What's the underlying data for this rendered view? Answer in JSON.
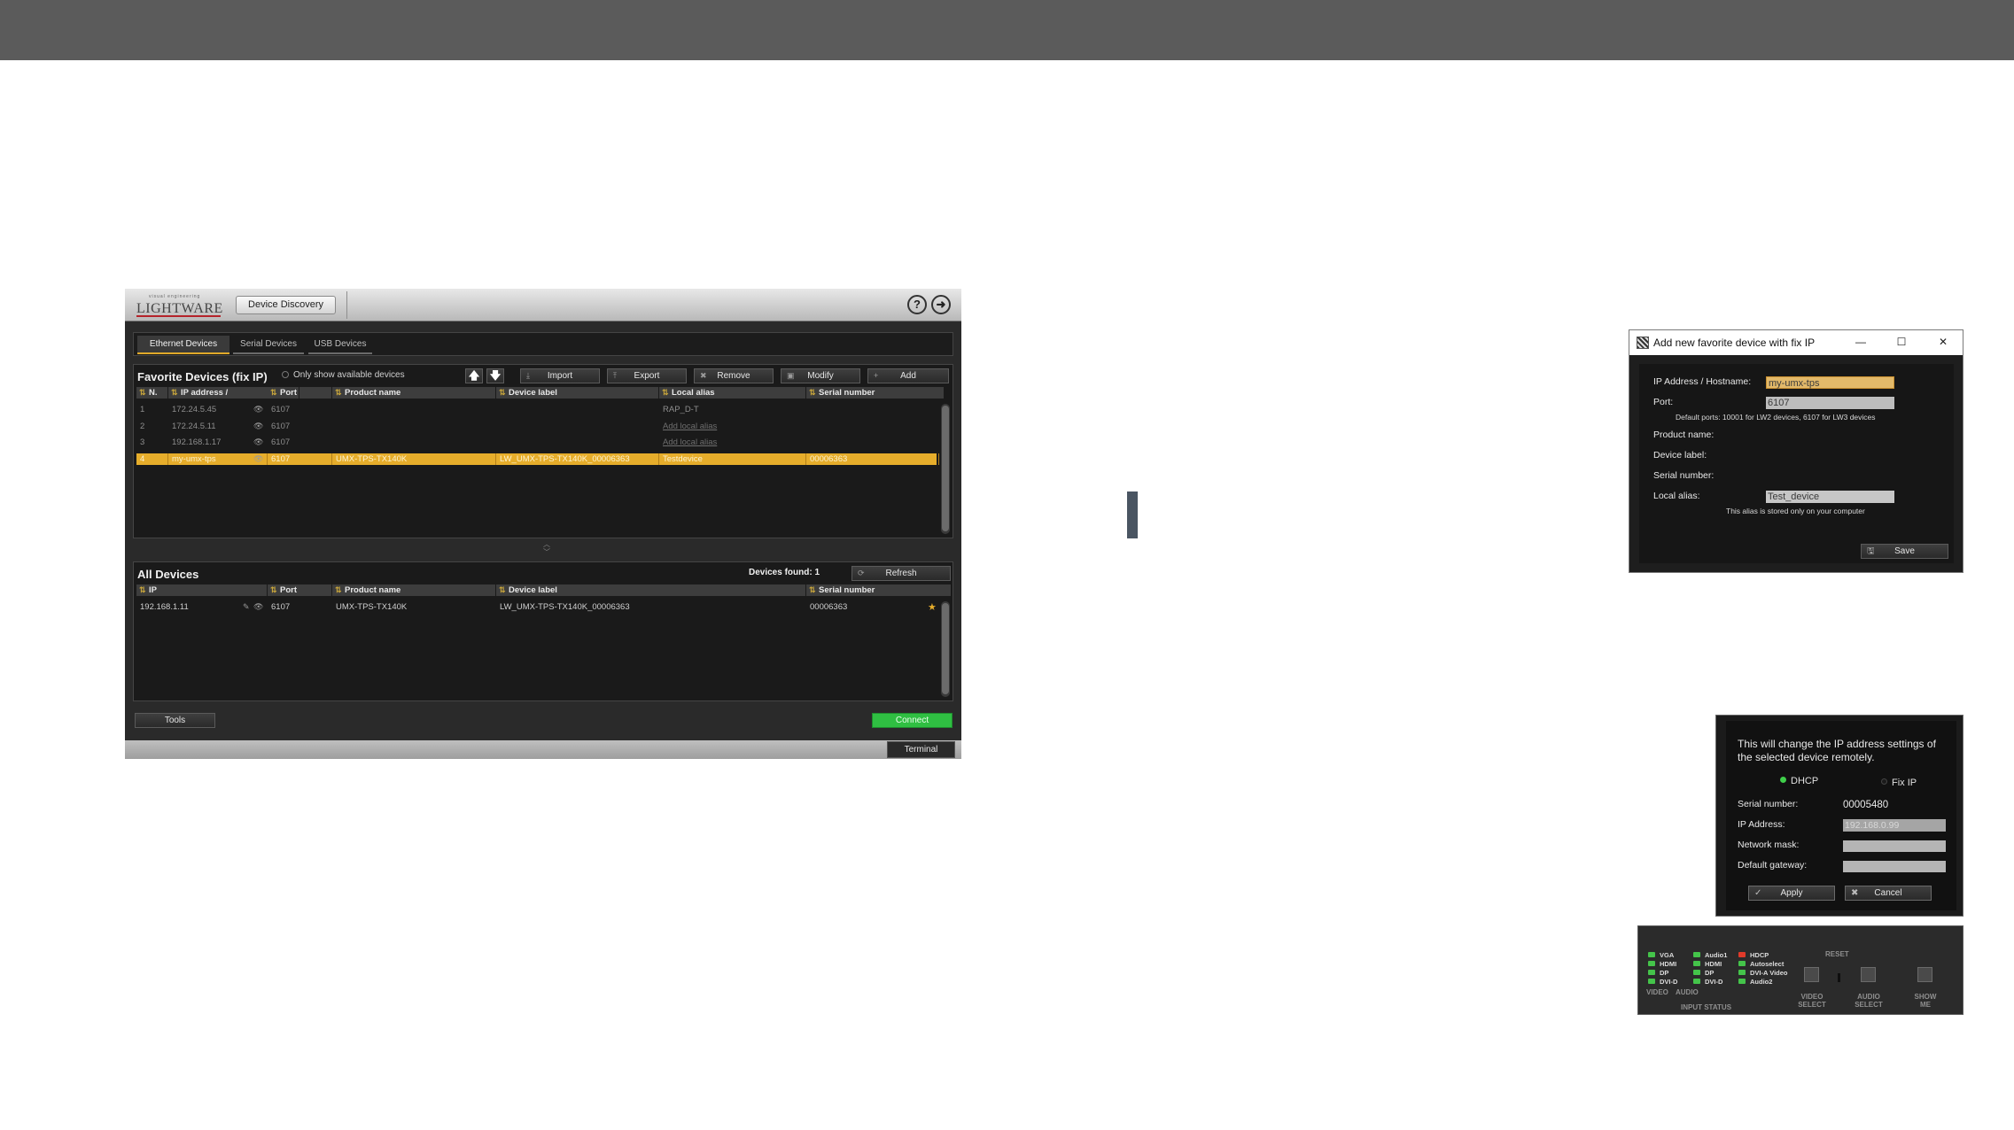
{
  "main_window": {
    "logo": {
      "small": "visual engineering",
      "big": "LIGHTWARE"
    },
    "discovery_button": "Device Discovery",
    "tabs": [
      "Ethernet Devices",
      "Serial Devices",
      "USB Devices"
    ],
    "favorites": {
      "title": "Favorite Devices (fix IP)",
      "only_available": "Only show available devices",
      "buttons": {
        "up": "🡅",
        "down": "🡇",
        "import": "Import",
        "export": "Export",
        "remove": "Remove",
        "modify": "Modify",
        "add": "Add"
      },
      "columns": [
        "N.",
        "IP address /",
        "Port",
        "Product name",
        "Device label",
        "Local alias",
        "Serial number"
      ],
      "rows": [
        {
          "n": "1",
          "ip": "172.24.5.45",
          "port": "6107",
          "product": "",
          "label": "",
          "alias": "RAP_D-T",
          "serial": "",
          "alias_placeholder": false,
          "selected": false
        },
        {
          "n": "2",
          "ip": "172.24.5.11",
          "port": "6107",
          "product": "",
          "label": "",
          "alias": "Add local alias",
          "serial": "",
          "alias_placeholder": true,
          "selected": false
        },
        {
          "n": "3",
          "ip": "192.168.1.17",
          "port": "6107",
          "product": "",
          "label": "",
          "alias": "Add local alias",
          "serial": "",
          "alias_placeholder": true,
          "selected": false
        },
        {
          "n": "4",
          "ip": "my-umx-tps",
          "port": "6107",
          "product": "UMX-TPS-TX140K",
          "label": "LW_UMX-TPS-TX140K_00006363",
          "alias": "Testdevice",
          "serial": "00006363",
          "alias_placeholder": false,
          "selected": true
        }
      ]
    },
    "all_devices": {
      "title": "All Devices",
      "devices_found": "Devices found: 1",
      "refresh": "Refresh",
      "columns": [
        "IP",
        "Port",
        "Product name",
        "Device label",
        "Serial number"
      ],
      "rows": [
        {
          "ip": "192.168.1.11",
          "port": "6107",
          "product": "UMX-TPS-TX140K",
          "label": "LW_UMX-TPS-TX140K_00006363",
          "serial": "00006363"
        }
      ]
    },
    "tools": "Tools",
    "connect": "Connect",
    "terminal": "Terminal"
  },
  "add_favorite_dialog": {
    "title": "Add new favorite device with fix IP",
    "ip_label": "IP Address / Hostname:",
    "ip_value": "my-umx-tps",
    "port_label": "Port:",
    "port_value": "6107",
    "ports_hint": "Default ports: 10001 for LW2 devices, 6107 for LW3 devices",
    "product_label": "Product name:",
    "device_label_label": "Device label:",
    "serial_label": "Serial number:",
    "alias_label": "Local alias:",
    "alias_value": "Test_device",
    "alias_hint": "This alias is stored only on your computer",
    "save": "Save"
  },
  "ip_settings_dialog": {
    "message": "This will change the IP address settings of the selected device remotely.",
    "dhcp": "DHCP",
    "fix_ip": "Fix IP",
    "serial_label": "Serial number:",
    "serial_value": "00005480",
    "ip_label": "IP Address:",
    "ip_value": "192.168.0.99",
    "mask_label": "Network mask:",
    "mask_value": "",
    "gateway_label": "Default gateway:",
    "gateway_value": "",
    "apply": "Apply",
    "cancel": "Cancel"
  },
  "front_panel": {
    "video_leds": [
      "VGA",
      "HDMI",
      "DP",
      "DVI-D"
    ],
    "audio_leds": [
      "Audio1",
      "HDMI",
      "DP",
      "DVI-D"
    ],
    "status_leds": [
      "HDCP",
      "Autoselect",
      "DVI-A Video",
      "Audio2"
    ],
    "video": "VIDEO",
    "audio": "AUDIO",
    "input_status": "INPUT STATUS",
    "reset": "RESET",
    "video_select": [
      "VIDEO",
      "SELECT"
    ],
    "audio_select": [
      "AUDIO",
      "SELECT"
    ],
    "show_me": [
      "SHOW",
      "ME"
    ]
  },
  "colors": {
    "topbar": "#5b5b5b",
    "selected_row": "#e6ad2b",
    "connect": "#2fbf42",
    "accent_logo": "#b5232a"
  }
}
